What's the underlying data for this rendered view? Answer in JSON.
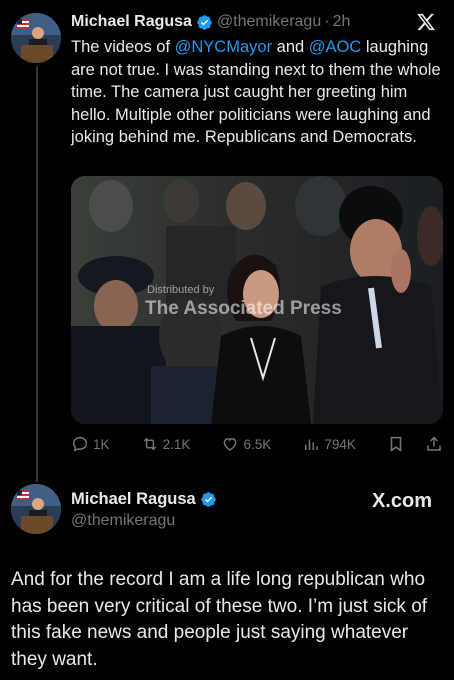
{
  "tweet1": {
    "name": "Michael Ragusa",
    "handle": "@themikeragu",
    "separator": "·",
    "time": "2h",
    "text_parts": {
      "p1": "The videos of ",
      "m1": "@NYCMayor",
      "p2": " and ",
      "m2": "@AOC",
      "p3": " laughing are not true. I was standing next to them the whole time. The camera just caught her greeting him hello. Multiple other politicians were laughing and joking behind me. Republicans and Democrats."
    },
    "photo_watermark": {
      "line1": "Distributed by",
      "line2": "The Associated Press"
    },
    "metrics": {
      "replies": "1K",
      "retweets": "2.1K",
      "likes": "6.5K",
      "views": "794K"
    }
  },
  "tweet2": {
    "name": "Michael Ragusa",
    "handle": "@themikeragu",
    "brand": "X.com",
    "text": "And for the record I am a life long republican who has been very critical of these two. I’m just sick of this fake news and people just saying whatever they want."
  },
  "colors": {
    "background": "#000000",
    "text": "#e7e9ea",
    "secondary": "#71767b",
    "link": "#1d9bf0",
    "verified": "#1d9bf0"
  },
  "icons": [
    "x-logo-icon",
    "verified-badge-icon",
    "reply-icon",
    "retweet-icon",
    "like-icon",
    "views-icon",
    "bookmark-icon",
    "share-icon"
  ]
}
